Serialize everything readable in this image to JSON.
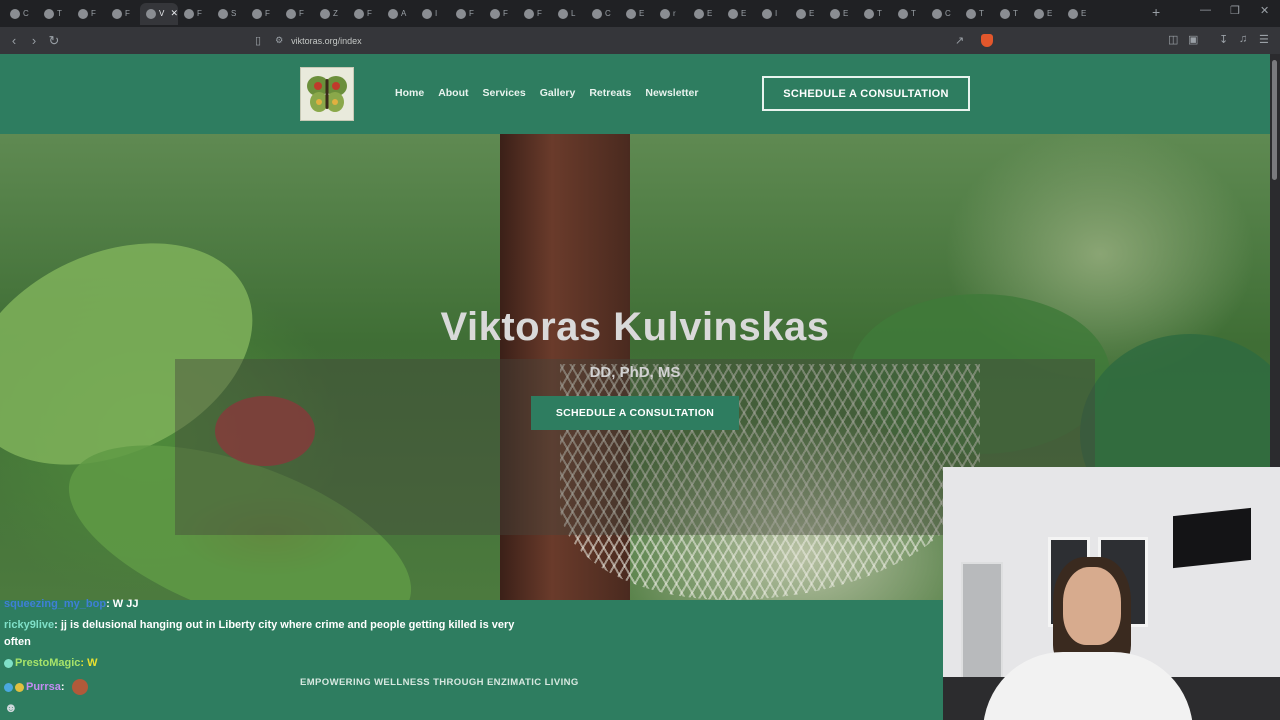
{
  "browser": {
    "tabs": [
      {
        "label": "C"
      },
      {
        "label": "T"
      },
      {
        "label": "F"
      },
      {
        "label": "F"
      },
      {
        "label": "V",
        "active": true
      },
      {
        "label": "F"
      },
      {
        "label": "S"
      },
      {
        "label": "F"
      },
      {
        "label": "F"
      },
      {
        "label": "Z"
      },
      {
        "label": "F"
      },
      {
        "label": "A"
      },
      {
        "label": "I"
      },
      {
        "label": "F"
      },
      {
        "label": "F"
      },
      {
        "label": "F"
      },
      {
        "label": "L"
      },
      {
        "label": "C"
      },
      {
        "label": "E"
      },
      {
        "label": "r"
      },
      {
        "label": "E"
      },
      {
        "label": "E"
      },
      {
        "label": "I"
      },
      {
        "label": "E"
      },
      {
        "label": "E"
      },
      {
        "label": "T"
      },
      {
        "label": "T"
      },
      {
        "label": "C"
      },
      {
        "label": "T"
      },
      {
        "label": "T"
      },
      {
        "label": "E"
      },
      {
        "label": "E"
      }
    ],
    "new_tab": "+",
    "url": "viktoras.org/index"
  },
  "site": {
    "nav": [
      "Home",
      "About",
      "Services",
      "Gallery",
      "Retreats",
      "Newsletter"
    ],
    "header_cta": "SCHEDULE A CONSULTATION",
    "hero_title": "Viktoras Kulvinskas",
    "hero_subtitle": "DD, PhD, MS",
    "hero_cta": "SCHEDULE A CONSULTATION",
    "tagline": "EMPOWERING WELLNESS THROUGH ENZIMATIC LIVING"
  },
  "chat": [
    {
      "user": "squeezing_my_bop",
      "text": ": W JJ"
    },
    {
      "user": "ricky9live",
      "text": ": jj is delusional hanging out in Liberty city where crime and people getting killed is very"
    },
    {
      "user": "",
      "text": "often"
    },
    {
      "user": "PrestoMagic",
      "text": ": W"
    },
    {
      "user": "Purrsa",
      "text": ":"
    }
  ],
  "colors": {
    "site_green": "#2e7d60",
    "browser_dark": "#202124"
  }
}
